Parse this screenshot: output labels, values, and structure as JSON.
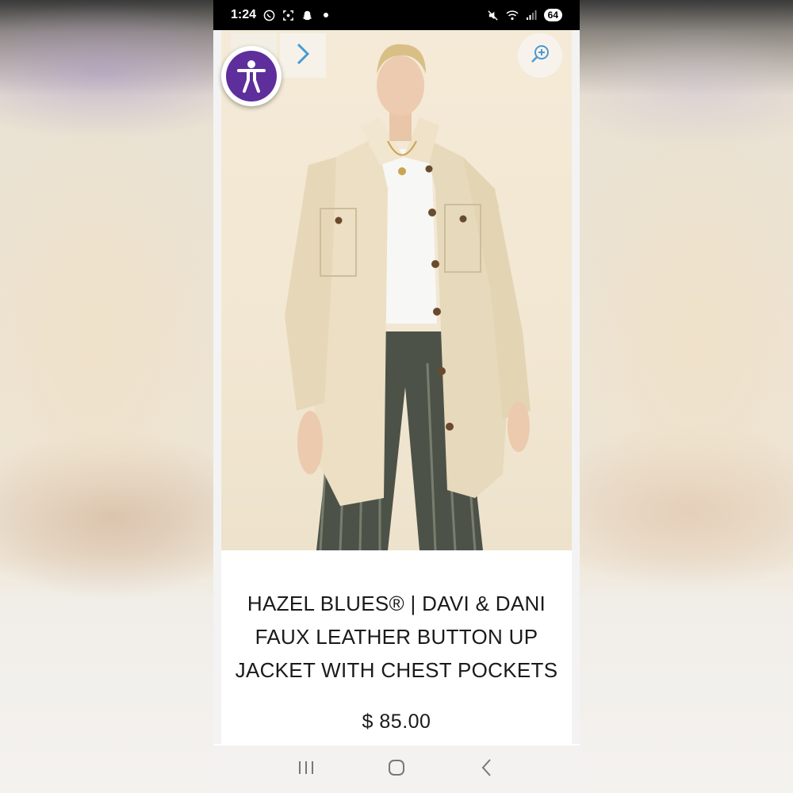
{
  "status_bar": {
    "time": "1:24",
    "battery": "64",
    "left_icons": [
      "whatsapp-icon",
      "screenshot-icon",
      "snapchat-icon",
      "dot-icon"
    ],
    "right_icons": [
      "mute-icon",
      "wifi-icon",
      "signal-icon",
      "battery-icon"
    ]
  },
  "gallery": {
    "image_alt": "Model wearing cream faux leather button up jacket with chest pockets",
    "prev_thumb_icon": "thumbnail",
    "next_icon": "chevron-right-icon",
    "zoom_icon": "zoom-in-icon",
    "accessibility_icon": "accessibility-icon"
  },
  "product": {
    "title_line1": "HAZEL BLUES® | DAVI & DANI",
    "title_line2": "FAUX LEATHER BUTTON UP",
    "title_line3": "JACKET WITH CHEST POCKETS",
    "price": "$ 85.00"
  },
  "colors": {
    "accessibility_purple": "#5d2e9c",
    "arrow_blue": "#4a9bd1",
    "jacket_cream": "#efe3c8"
  },
  "nav_bar": {
    "icons": [
      "recent-apps-icon",
      "home-icon",
      "back-icon"
    ]
  }
}
